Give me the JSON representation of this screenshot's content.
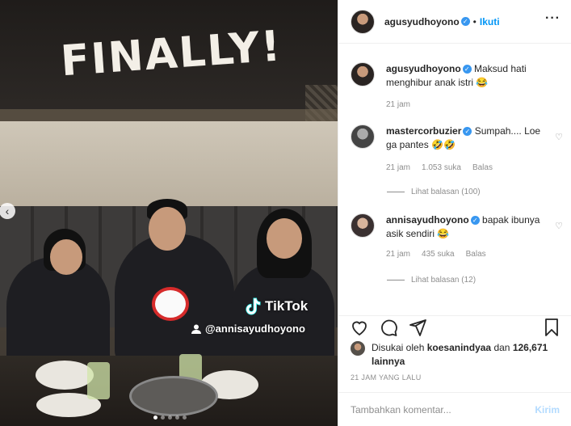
{
  "media": {
    "overlay_title": "FINALLY!",
    "tiktok_label": "TikTok",
    "tiktok_user": "@annisayudhoyono",
    "carousel_dots": 5,
    "active_dot": 1
  },
  "header": {
    "username": "agusyudhoyono",
    "separator": "•",
    "follow_label": "Ikuti",
    "more_label": "···"
  },
  "comments": [
    {
      "username": "agusyudhoyono",
      "text": "Maksud hati menghibur anak istri 😂",
      "time": "21 jam",
      "verified": true
    },
    {
      "username": "mastercorbuzier",
      "text": "Sumpah.... Loe ga pantes 🤣🤣",
      "time": "21 jam",
      "likes": "1.053 suka",
      "reply": "Balas",
      "view_replies": "Lihat balasan (100)",
      "verified": true
    },
    {
      "username": "annisayudhoyono",
      "text": "bapak ibunya asik sendiri 😂",
      "time": "21 jam",
      "likes": "435 suka",
      "reply": "Balas",
      "view_replies": "Lihat balasan (12)",
      "verified": true
    }
  ],
  "likes": {
    "prefix": "Disukai oleh",
    "user": "koesanindyaa",
    "connector": "dan",
    "count": "126,671",
    "suffix": "lainnya"
  },
  "timestamp": "21 JAM YANG LALU",
  "add_comment": {
    "placeholder": "Tambahkan komentar...",
    "post_label": "Kirim"
  },
  "colors": {
    "link_blue": "#0095f6",
    "verified_blue": "#3897f0",
    "post_disabled": "#b3dbff",
    "muted": "#8e8e8e"
  },
  "icons": [
    "heart-icon",
    "comment-icon",
    "share-icon",
    "bookmark-icon",
    "more-icon",
    "verified-icon",
    "chevron-left-icon",
    "tiktok-icon",
    "user-icon"
  ]
}
